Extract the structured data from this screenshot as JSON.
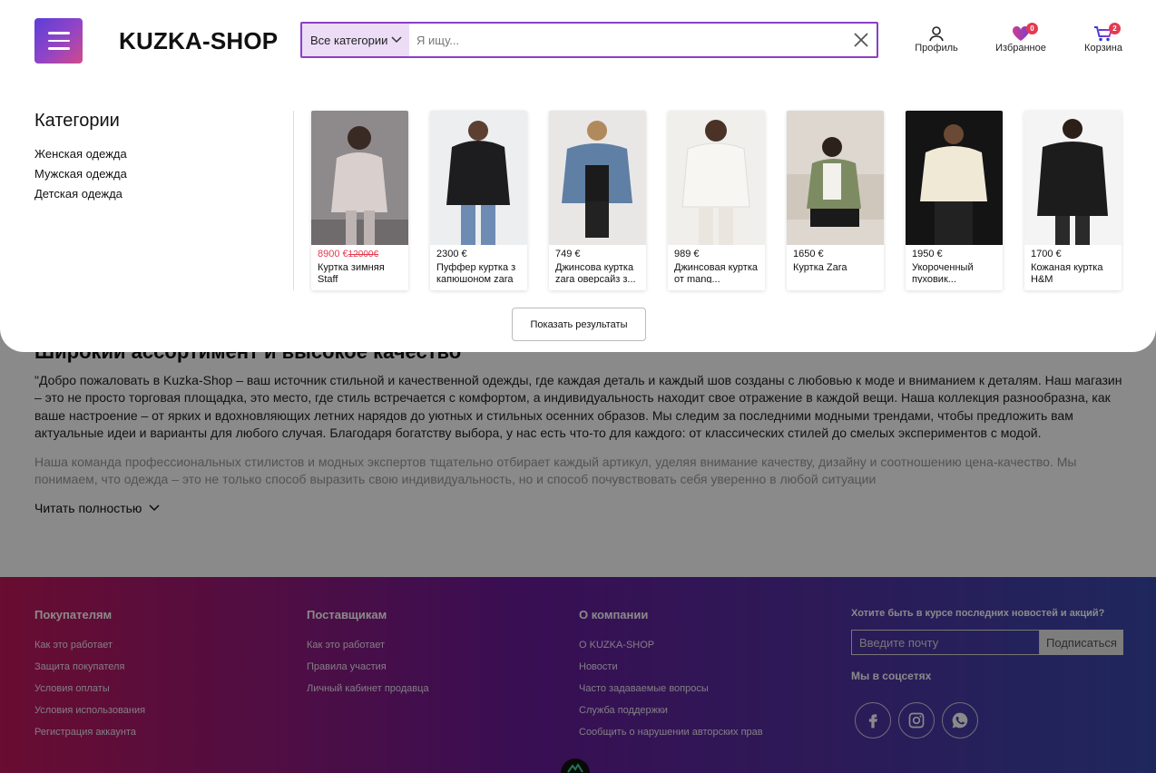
{
  "header": {
    "brand": "KUZKA-SHOP",
    "search": {
      "category": "Все категории",
      "placeholder": "Я ищу..."
    },
    "profile_label": "Профиль",
    "favorites_label": "Избранное",
    "favorites_count": "0",
    "cart_label": "Корзина",
    "cart_count": "2"
  },
  "dropdown": {
    "categories_title": "Категории",
    "categories": [
      "Женская одежда",
      "Мужская одежда",
      "Детская одежда"
    ],
    "products": [
      {
        "price": "8900 €",
        "old_price": "12000€",
        "title": "Куртка зимняя Staff",
        "on_sale": true
      },
      {
        "price": "2300 €",
        "old_price": "",
        "title": "Пуффер куртка з капюшоном zara",
        "on_sale": false
      },
      {
        "price": "749 €",
        "old_price": "",
        "title": "Джинсова куртка zara оверсайз з...",
        "on_sale": false
      },
      {
        "price": "989 €",
        "old_price": "",
        "title": "Джинсовая куртка от mang...",
        "on_sale": false
      },
      {
        "price": "1650 €",
        "old_price": "",
        "title": "Куртка Zara",
        "on_sale": false
      },
      {
        "price": "1950 €",
        "old_price": "",
        "title": "Укороченный пуховик...",
        "on_sale": false
      },
      {
        "price": "1700 €",
        "old_price": "",
        "title": "Кожаная куртка H&M",
        "on_sale": false
      }
    ],
    "show_results": "Показать результаты"
  },
  "about": {
    "heading": "Широкий ассортимент и высокое качество",
    "p1": "\"Добро пожаловать в Kuzka-Shop – ваш источник стильной и качественной одежды, где каждая деталь и каждый шов созданы с любовью к моде и вниманием к деталям. Наш магазин – это не просто торговая площадка, это место, где стиль встречается с комфортом, а индивидуальность находит свое отражение в каждой вещи. Наша коллекция разнообразна, как ваше настроение – от ярких и вдохновляющих летних нарядов до уютных и стильных осенних образов. Мы следим за последними модными трендами, чтобы предложить вам актуальные идеи и варианты для любого случая. Благодаря богатству выбора, у нас есть что-то для каждого: от классических стилей до смелых экспериментов с модой.",
    "p2": "Наша команда профессиональных стилистов и модных экспертов тщательно отбирает каждый артикул, уделяя внимание качеству, дизайну и соотношению цена-качество. Мы понимаем, что одежда – это не только способ выразить свою индивидуальность, но и способ почувствовать себя уверенно в любой ситуации",
    "read_more": "Читать полностью"
  },
  "footer": {
    "buyers": {
      "title": "Покупателям",
      "links": [
        "Как это работает",
        "Защита покупателя",
        "Условия оплаты",
        "Условия использования",
        "Регистрация аккаунта"
      ]
    },
    "suppliers": {
      "title": "Поставщикам",
      "links": [
        "Как это работает",
        "Правила участия",
        "Личный кабинет продавца"
      ]
    },
    "company": {
      "title": "О компании",
      "links": [
        "О KUZKA-SHOP",
        "Новости",
        "Часто задаваемые вопросы",
        "Служба поддержки",
        "Сообщить о нарушении авторских прав"
      ]
    },
    "newsletter": {
      "title": "Хотите быть в курсе последних новостей и акций?",
      "email_placeholder": "Введите почту",
      "subscribe": "Подписаться"
    },
    "social_title": "Мы в соцсетях"
  },
  "colors": {
    "accent": "#8a3fc8",
    "sale": "#e53950",
    "footer_from": "#c2185b",
    "footer_to": "#3949ab"
  }
}
